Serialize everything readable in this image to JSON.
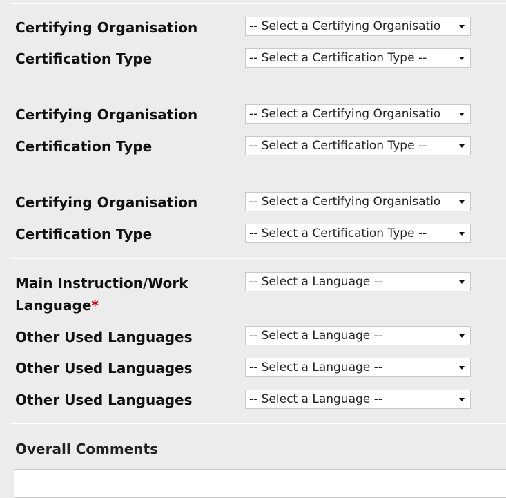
{
  "certifications": [
    {
      "org_label": "Certifying Organisation",
      "org_value": "-- Select a Certifying Organisatio",
      "type_label": "Certification Type",
      "type_value": "-- Select a Certification Type --"
    },
    {
      "org_label": "Certifying Organisation",
      "org_value": "-- Select a Certifying Organisatio",
      "type_label": "Certification Type",
      "type_value": "-- Select a Certification Type --"
    },
    {
      "org_label": "Certifying Organisation",
      "org_value": "-- Select a Certifying Organisatio",
      "type_label": "Certification Type",
      "type_value": "-- Select a Certification Type --"
    }
  ],
  "languages": {
    "main_label": "Main Instruction/Work Language",
    "required_mark": "*",
    "main_value": "-- Select a Language --",
    "other": [
      {
        "label": "Other Used Languages",
        "value": "-- Select a Language --"
      },
      {
        "label": "Other Used Languages",
        "value": "-- Select a Language --"
      },
      {
        "label": "Other Used Languages",
        "value": "-- Select a Language --"
      }
    ]
  },
  "comments": {
    "label": "Overall Comments",
    "value": ""
  }
}
